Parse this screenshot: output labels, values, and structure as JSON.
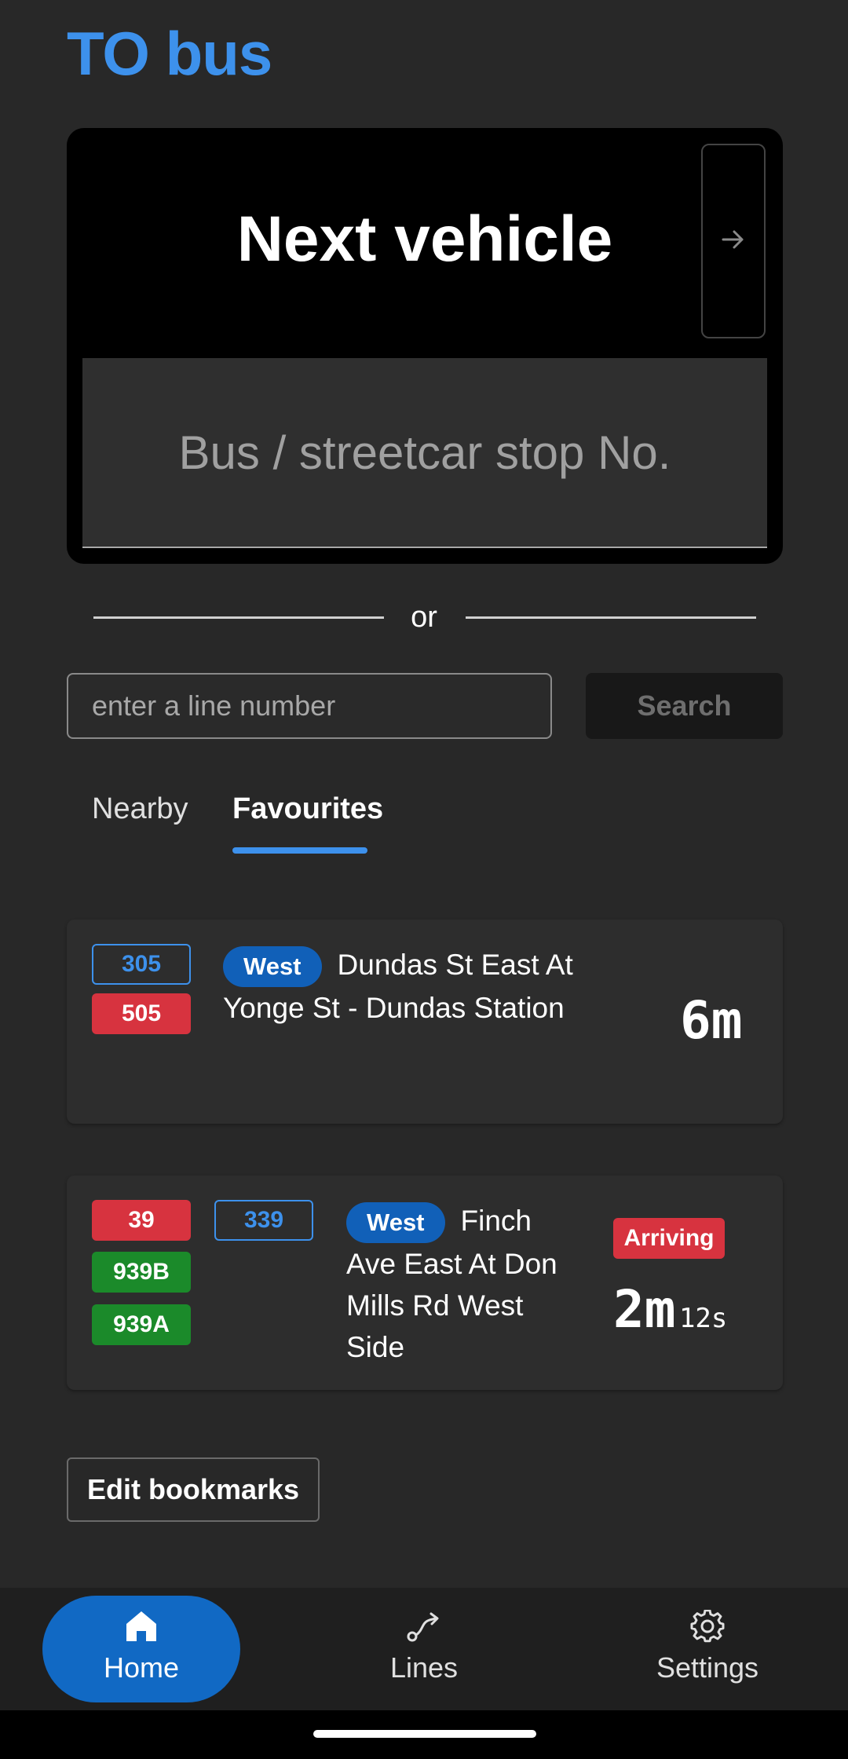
{
  "app": {
    "title": "TO bus"
  },
  "next_vehicle": {
    "title": "Next vehicle",
    "arrow_icon": "arrow-right-icon",
    "stop_placeholder": "Bus / streetcar stop No."
  },
  "divider": {
    "text": "or"
  },
  "line_search": {
    "placeholder": "enter a line number",
    "button_label": "Search"
  },
  "tabs": [
    {
      "label": "Nearby",
      "active": false
    },
    {
      "label": "Favourites",
      "active": true
    }
  ],
  "favourites": [
    {
      "routes_col1": [
        {
          "label": "305",
          "style": "outline"
        },
        {
          "label": "505",
          "style": "red"
        }
      ],
      "routes_col2": [],
      "direction": "West",
      "stop_name": "Dundas St East At Yonge St - Dundas Station",
      "eta_minutes": "6m",
      "eta_seconds": "",
      "arriving": ""
    },
    {
      "routes_col1": [
        {
          "label": "39",
          "style": "red"
        },
        {
          "label": "939B",
          "style": "green"
        },
        {
          "label": "939A",
          "style": "green"
        }
      ],
      "routes_col2": [
        {
          "label": "339",
          "style": "outline"
        }
      ],
      "direction": "West",
      "stop_name": "Finch Ave East At Don Mills Rd West Side",
      "eta_minutes": "2m",
      "eta_seconds": "12s",
      "arriving": "Arriving"
    }
  ],
  "edit_bookmarks": {
    "label": "Edit bookmarks"
  },
  "bottom_nav": [
    {
      "label": "Home",
      "icon": "home-icon",
      "active": true
    },
    {
      "label": "Lines",
      "icon": "route-icon",
      "active": false
    },
    {
      "label": "Settings",
      "icon": "gear-icon",
      "active": false
    }
  ],
  "colors": {
    "accent": "#3d91ec",
    "badge_red": "#d7333f",
    "badge_green": "#1b8a2a",
    "direction_pill": "#1160b8",
    "nav_active": "#1169c4"
  }
}
